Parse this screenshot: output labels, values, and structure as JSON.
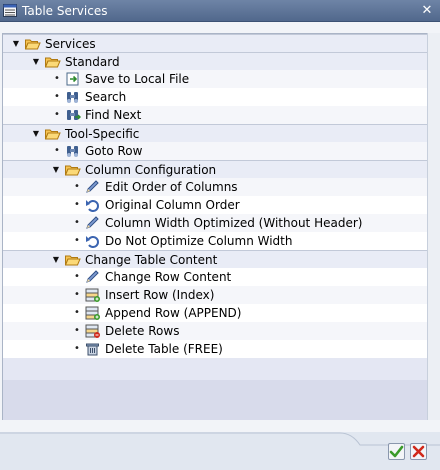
{
  "window": {
    "title": "Table Services"
  },
  "tree": [
    {
      "kind": "folder",
      "level": 0,
      "label": "Services",
      "icon": "folder-open-icon"
    },
    {
      "kind": "folder",
      "level": 1,
      "label": "Standard",
      "icon": "folder-open-icon"
    },
    {
      "kind": "leaf",
      "level": 2,
      "label": "Save to Local File",
      "icon": "save-to-file-icon"
    },
    {
      "kind": "leaf",
      "level": 2,
      "label": "Search",
      "icon": "binoculars-icon"
    },
    {
      "kind": "leaf",
      "level": 2,
      "label": "Find Next",
      "icon": "binoculars-next-icon"
    },
    {
      "kind": "folder",
      "level": 1,
      "label": "Tool-Specific",
      "icon": "folder-open-icon"
    },
    {
      "kind": "leaf",
      "level": 2,
      "label": "Goto Row",
      "icon": "binoculars-icon"
    },
    {
      "kind": "folder",
      "level": 2,
      "label": "Column Configuration",
      "icon": "folder-open-icon"
    },
    {
      "kind": "leaf",
      "level": 3,
      "label": "Edit Order of Columns",
      "icon": "pencil-icon"
    },
    {
      "kind": "leaf",
      "level": 3,
      "label": "Original Column Order",
      "icon": "undo-arrow-icon"
    },
    {
      "kind": "leaf",
      "level": 3,
      "label": "Column Width Optimized (Without Header)",
      "icon": "pencil-icon"
    },
    {
      "kind": "leaf",
      "level": 3,
      "label": "Do Not Optimize Column Width",
      "icon": "undo-arrow-icon"
    },
    {
      "kind": "folder",
      "level": 2,
      "label": "Change Table Content",
      "icon": "folder-open-icon"
    },
    {
      "kind": "leaf",
      "level": 3,
      "label": "Change Row Content",
      "icon": "pencil-icon"
    },
    {
      "kind": "leaf",
      "level": 3,
      "label": "Insert Row (Index)",
      "icon": "insert-row-icon"
    },
    {
      "kind": "leaf",
      "level": 3,
      "label": "Append Row (APPEND)",
      "icon": "append-row-icon"
    },
    {
      "kind": "leaf",
      "level": 3,
      "label": "Delete Rows",
      "icon": "delete-row-icon"
    },
    {
      "kind": "leaf",
      "level": 3,
      "label": "Delete Table (FREE)",
      "icon": "trash-icon"
    }
  ],
  "footer": {
    "confirm_icon": "checkmark-icon",
    "cancel_icon": "cancel-x-icon"
  },
  "colors": {
    "titlebar": "#5a7095",
    "folder": "#f2b640",
    "confirm": "#3a9a2a",
    "cancel": "#d0281a"
  }
}
